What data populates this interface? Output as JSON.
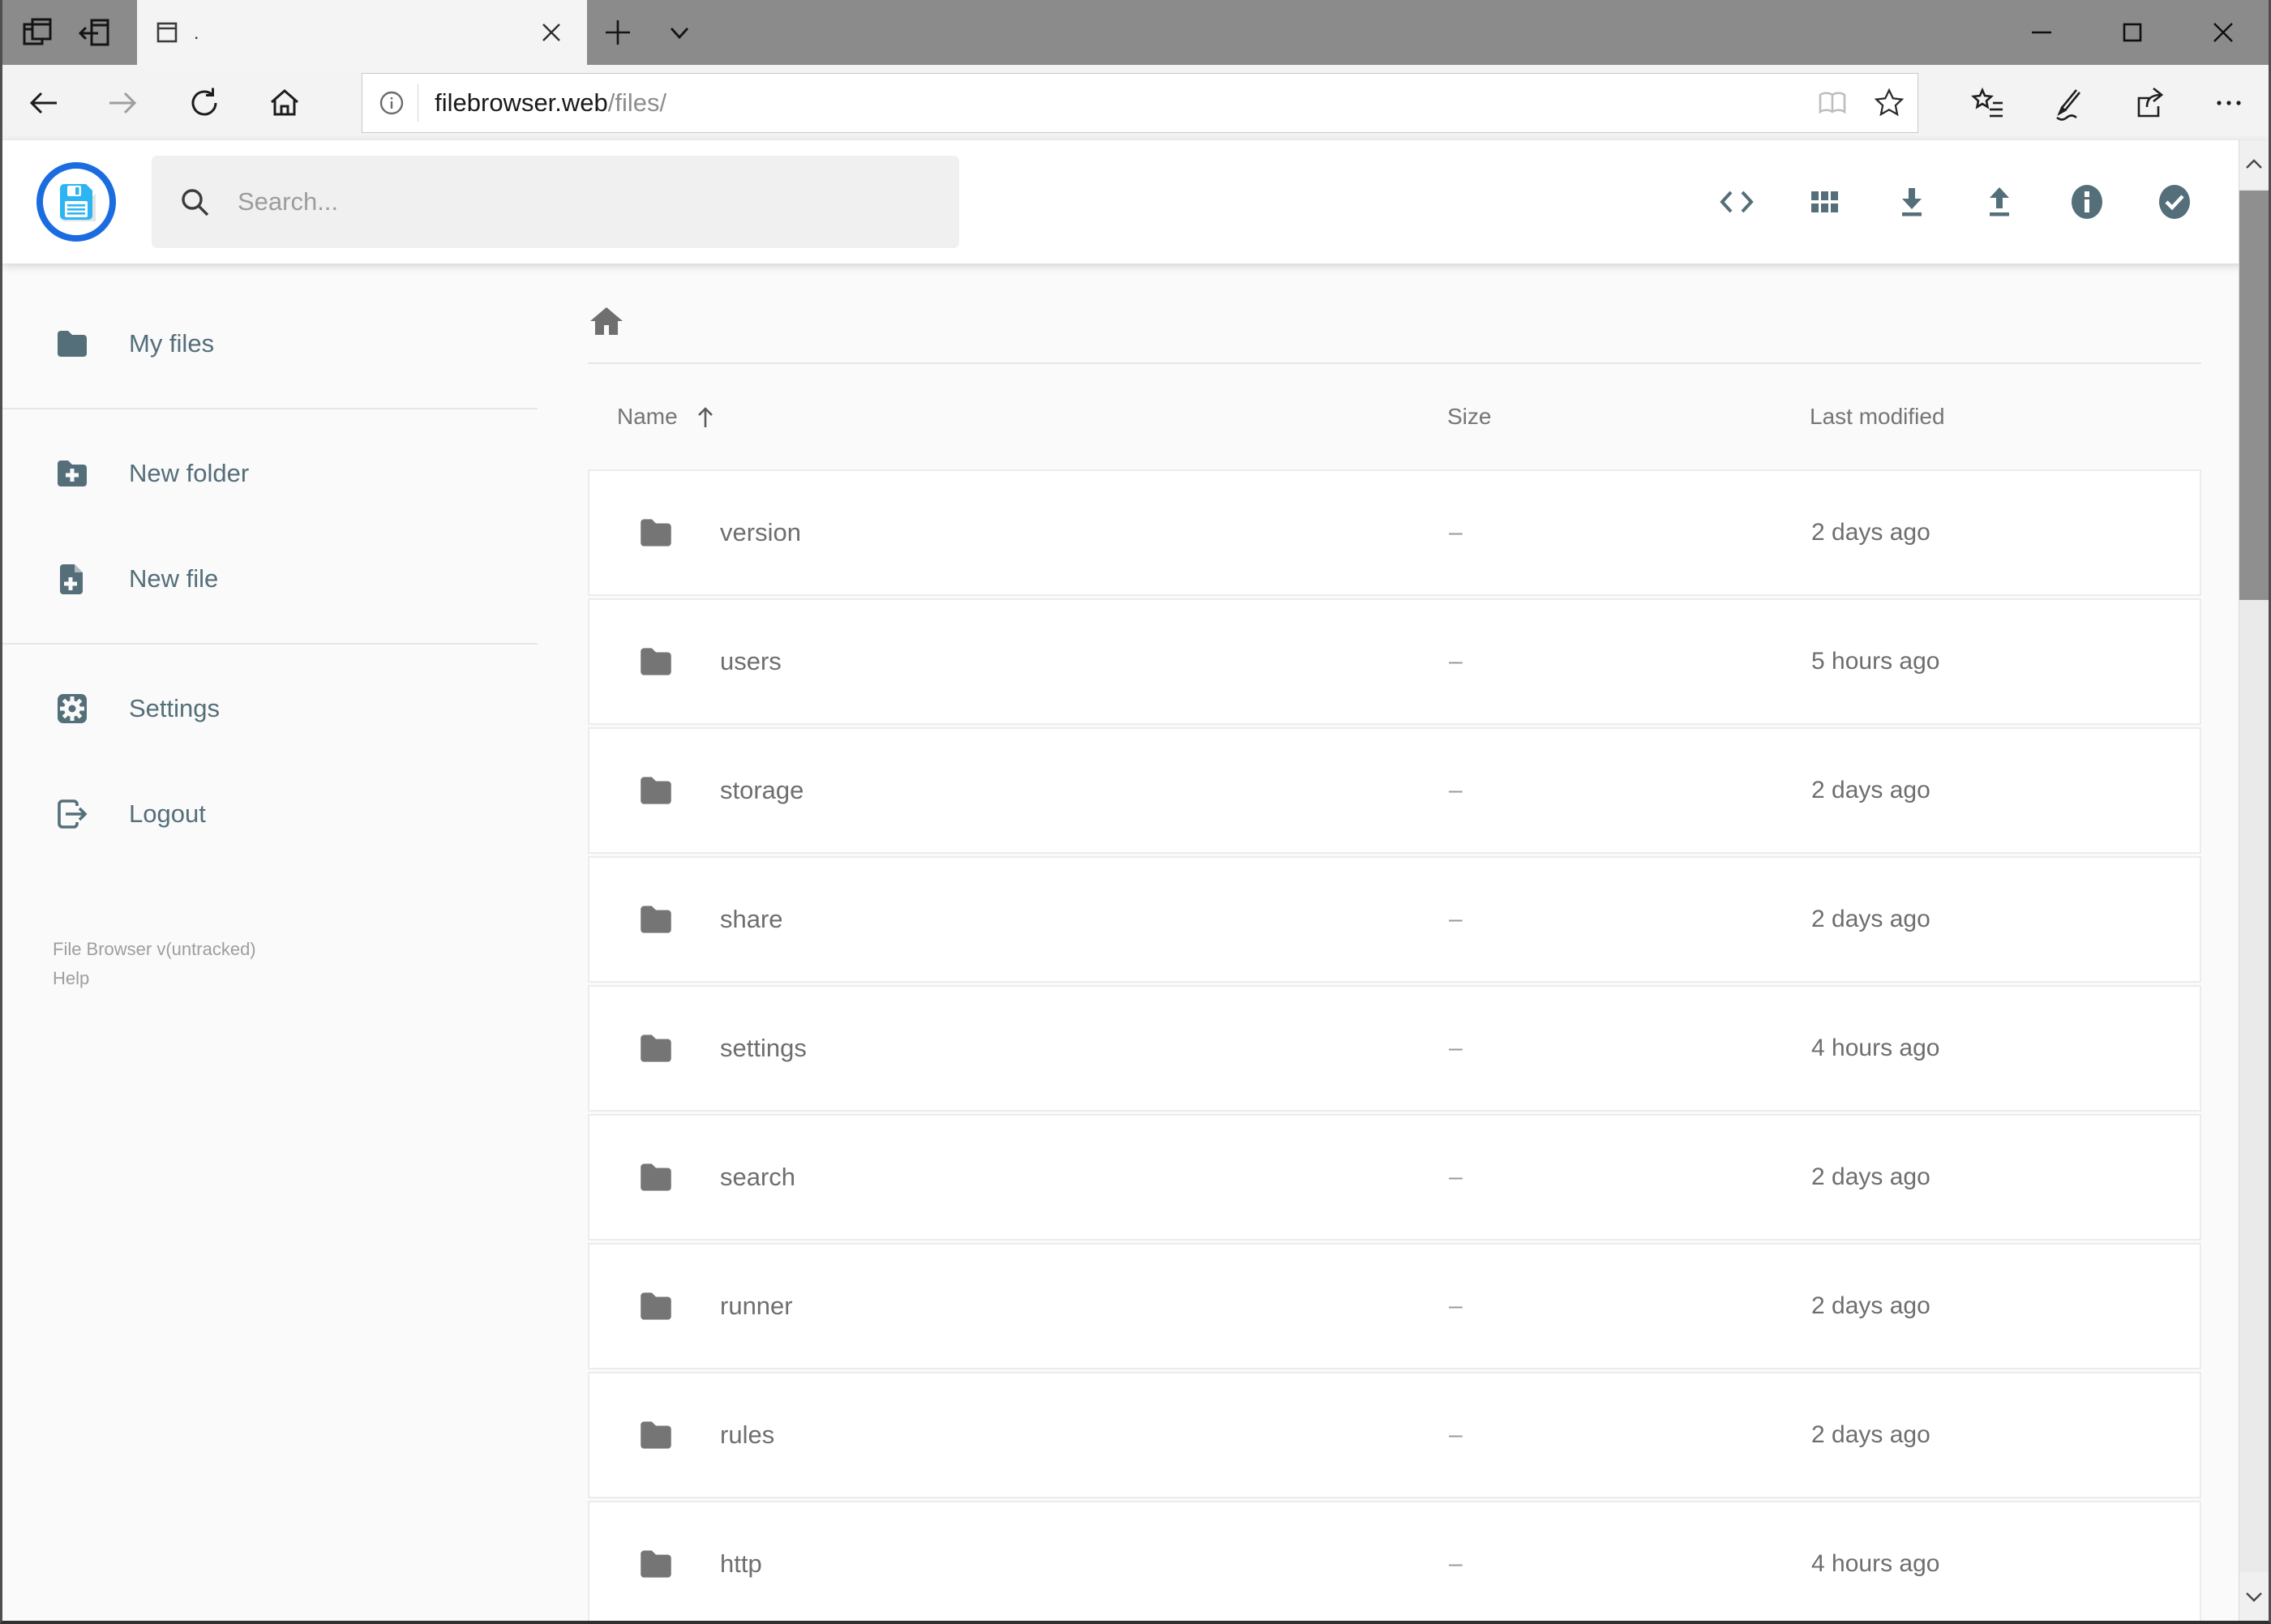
{
  "browser": {
    "tab": {
      "title": "."
    },
    "address": {
      "host": "filebrowser.web",
      "path": "/files/"
    }
  },
  "app": {
    "search": {
      "placeholder": "Search..."
    },
    "sidebar": {
      "items": [
        {
          "label": "My files"
        },
        {
          "label": "New folder"
        },
        {
          "label": "New file"
        },
        {
          "label": "Settings"
        },
        {
          "label": "Logout"
        }
      ],
      "footer": {
        "version": "File Browser v(untracked)",
        "help": "Help"
      }
    },
    "listing": {
      "columns": {
        "name": "Name",
        "size": "Size",
        "modified": "Last modified"
      },
      "rows": [
        {
          "name": "version",
          "size": "–",
          "modified": "2 days ago"
        },
        {
          "name": "users",
          "size": "–",
          "modified": "5 hours ago"
        },
        {
          "name": "storage",
          "size": "–",
          "modified": "2 days ago"
        },
        {
          "name": "share",
          "size": "–",
          "modified": "2 days ago"
        },
        {
          "name": "settings",
          "size": "–",
          "modified": "4 hours ago"
        },
        {
          "name": "search",
          "size": "–",
          "modified": "2 days ago"
        },
        {
          "name": "runner",
          "size": "–",
          "modified": "2 days ago"
        },
        {
          "name": "rules",
          "size": "–",
          "modified": "2 days ago"
        },
        {
          "name": "http",
          "size": "–",
          "modified": "4 hours ago"
        }
      ]
    },
    "colors": {
      "accent": "#546e7a",
      "logo_ring": "#1b6ce0",
      "logo_floppy": "#2cb5f2"
    }
  }
}
